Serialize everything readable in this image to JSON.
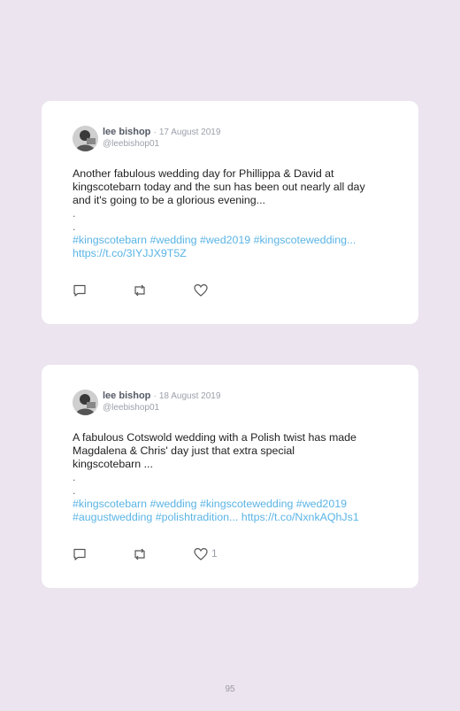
{
  "tweets": [
    {
      "name": "lee bishop",
      "separator": "·",
      "date": "17 August 2019",
      "handle": "@leebishop01",
      "text_lines": [
        "Another fabulous wedding day for Phillippa & David at",
        "kingscotebarn today and the sun has been out nearly all day",
        "and it's going to be a glorious evening..."
      ],
      "dot1": ".",
      "dot2": ".",
      "link_lines": [
        "#kingscotebarn #wedding #wed2019 #kingscotewedding...",
        "https://t.co/3IYJJX9T5Z"
      ],
      "like_count": ""
    },
    {
      "name": "lee bishop",
      "separator": "·",
      "date": "18 August 2019",
      "handle": "@leebishop01",
      "text_lines": [
        "A fabulous Cotswold wedding with a Polish twist has made",
        "Magdalena & Chris' day just that extra special",
        "kingscotebarn ..."
      ],
      "dot1": ".",
      "dot2": ".",
      "link_lines": [
        "#kingscotebarn #wedding #kingscotewedding #wed2019",
        "#augustwedding #polishtradition... https://t.co/NxnkAQhJs1"
      ],
      "like_count": "1"
    }
  ],
  "icons": {
    "reply": "reply-icon",
    "retweet": "retweet-icon",
    "like": "heart-icon",
    "avatar": "avatar-photo"
  },
  "colors": {
    "background": "#ece4ef",
    "card": "#ffffff",
    "link": "#5ab4e5",
    "muted": "#9aa0aa"
  },
  "page_number": "95"
}
